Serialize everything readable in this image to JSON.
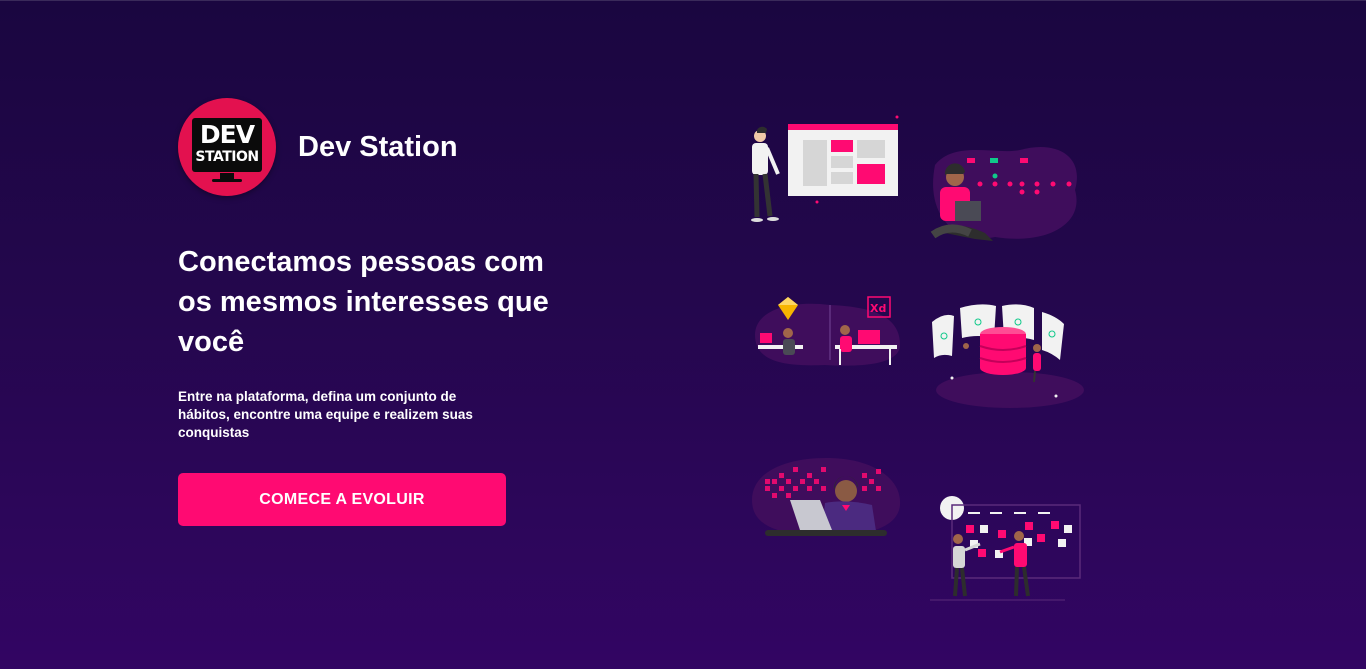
{
  "brand": {
    "logo_line1": "DEV",
    "logo_line2": "STATION",
    "name": "Dev Station"
  },
  "hero": {
    "headline": "Conectamos pessoas com os mesmos interesses que você",
    "description": "Entre na plataforma, defina um conjunto de hábitos, encontre uma equipe e realizem suas conquistas",
    "cta_label": "COMECE A EVOLUIR"
  },
  "illustrations": {
    "design_badge": "Xd"
  },
  "colors": {
    "accent": "#ff0a72",
    "logo_bg": "#e3114f",
    "background_top": "#1a0640",
    "background_bottom": "#320563"
  },
  "icons": [
    "presenting-board-illustration",
    "laptop-user-illustration",
    "design-team-illustration",
    "database-illustration",
    "coding-laptop-illustration",
    "kanban-board-illustration"
  ]
}
